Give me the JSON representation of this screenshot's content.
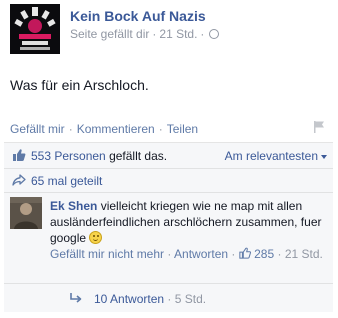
{
  "post": {
    "author": "Kein Bock Auf Nazis",
    "meta_liked": "Seite gefällt dir",
    "meta_time": "21 Std.",
    "meta_dot": "·",
    "text": "Was für ein Arschloch.",
    "avatar_logo_text": "KEIN BOCK AUF NAZIS"
  },
  "actions": {
    "like": "Gefällt mir",
    "comment": "Kommentieren",
    "share": "Teilen",
    "sep": "·"
  },
  "likes": {
    "people_link": "553 Personen",
    "suffix": "gefällt das.",
    "sort_label": "Am relevantesten"
  },
  "shares": {
    "label": "65 mal geteilt"
  },
  "comment": {
    "author": "Ek Shen",
    "text": "vielleicht kriegen wie ne map mit allen ausländerfeindlichen arschlöchern zusammen, fuer google",
    "unlike": "Gefällt mir nicht mehr",
    "reply": "Antworten",
    "like_count": "285",
    "time": "21 Std.",
    "sep": "·"
  },
  "replies": {
    "label": "10 Antworten",
    "time": "5 Std.",
    "sep": "·"
  },
  "colors": {
    "link": "#3b5998",
    "muted": "#9197a3",
    "ufi_bg": "#f6f7f9"
  },
  "icons": {
    "like": "thumbs-up-icon",
    "share": "share-arrow-icon",
    "reply": "reply-arrow-icon",
    "flag": "flag-icon",
    "privacy": "globe-icon",
    "emoji": "smiley-icon"
  }
}
